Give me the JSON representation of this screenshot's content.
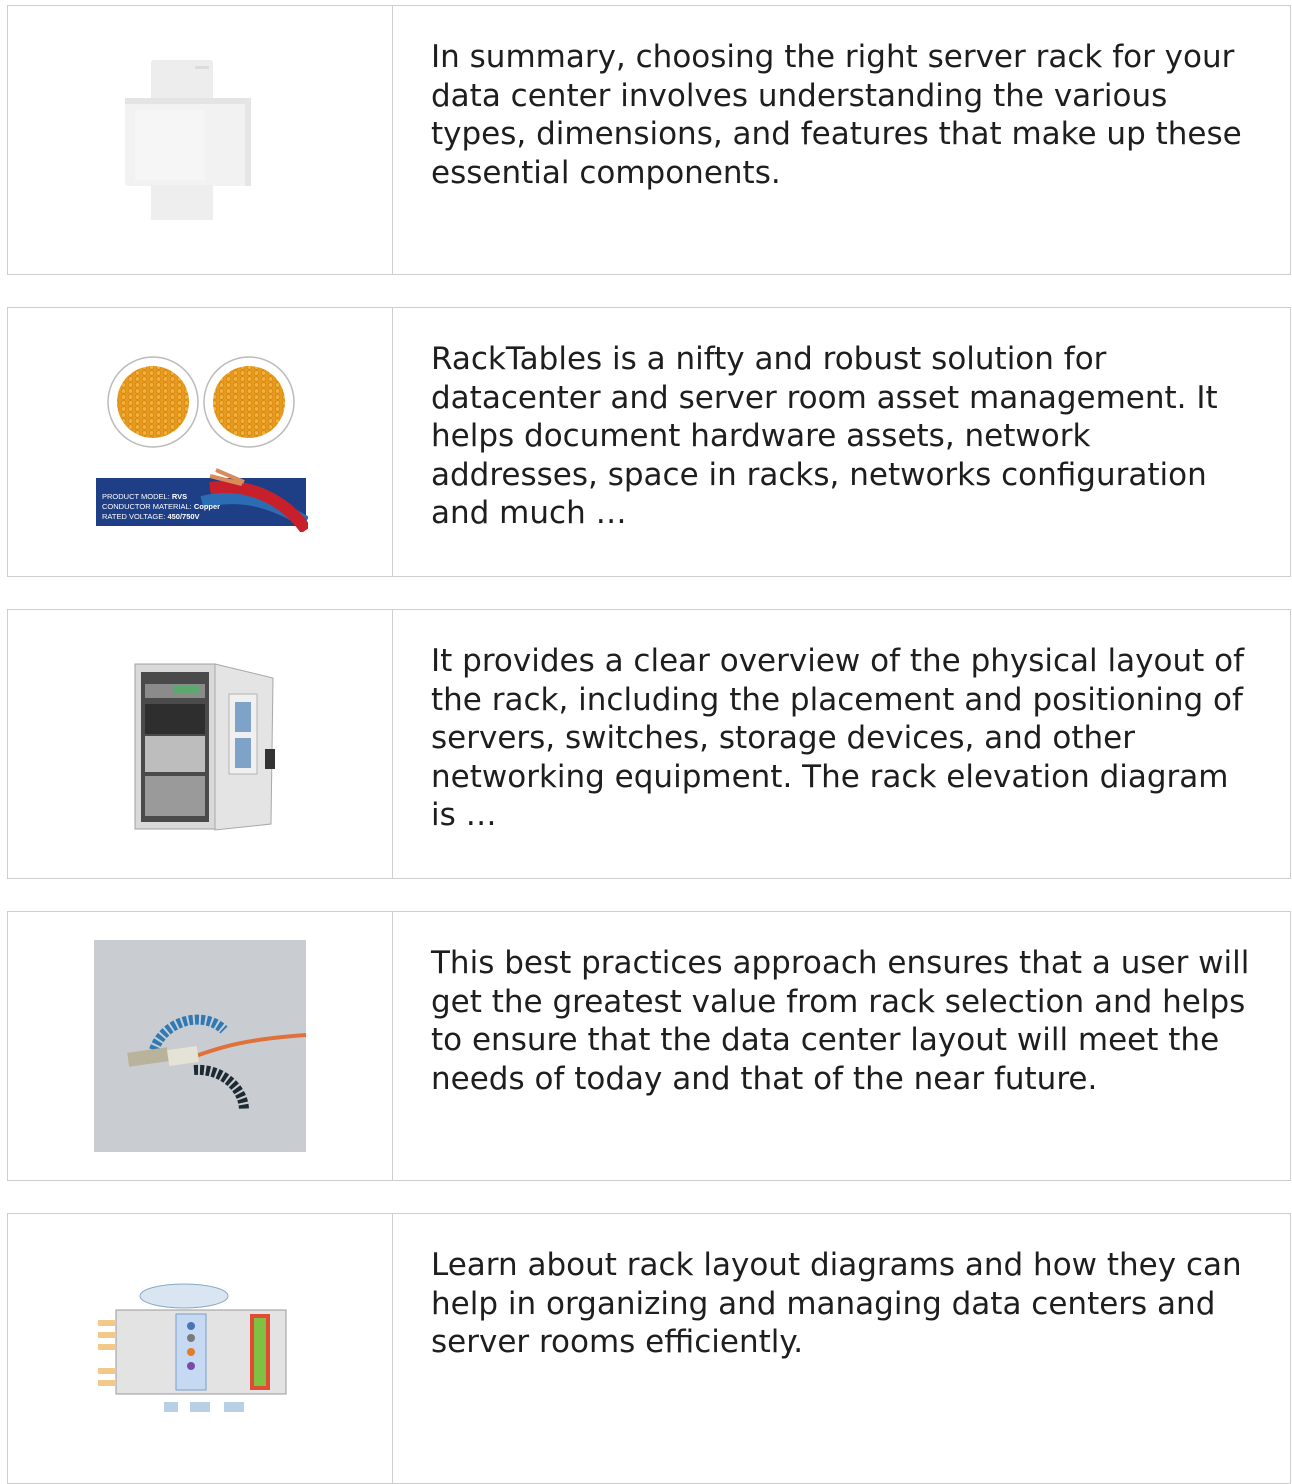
{
  "cards": [
    {
      "image_label": "din-rail-module-image",
      "text": "In summary, choosing the right server rack for your data center involves understanding the various types, dimensions, and features that make up these essential components."
    },
    {
      "image_label": "cable-product-image",
      "image_text": {
        "line1_label": "PRODUCT MODEL: ",
        "line1_value": "RVS",
        "line2_label": "CONDUCTOR MATERIAL: ",
        "line2_value": "Copper",
        "line3_label": "RATED VOLTAGE: ",
        "line3_value": "450/750V"
      },
      "text": "RackTables is a nifty and robust solution for datacenter and server room asset management. It helps document hardware assets, network addresses, space in racks, networks configuration and much …"
    },
    {
      "image_label": "outdoor-cabinet-image",
      "text": "It provides a clear overview of the physical layout of the rack, including the placement and positioning of servers, switches, storage devices, and other networking equipment. The rack elevation diagram is …"
    },
    {
      "image_label": "fiber-patch-cord-image",
      "text": "This best practices approach ensures that a user will get the greatest value from rack selection and helps to ensure that the data center layout will meet the needs of today and that of the near future."
    },
    {
      "image_label": "network-diagram-image",
      "text": "Learn about rack layout diagrams and how they can help in organizing and managing data centers and server rooms efficiently."
    }
  ],
  "colors": {
    "border": "#cfcfcf",
    "text": "#1e1e1e",
    "cable_orange": "#e89a1c",
    "label_navy": "#1e3f86"
  }
}
